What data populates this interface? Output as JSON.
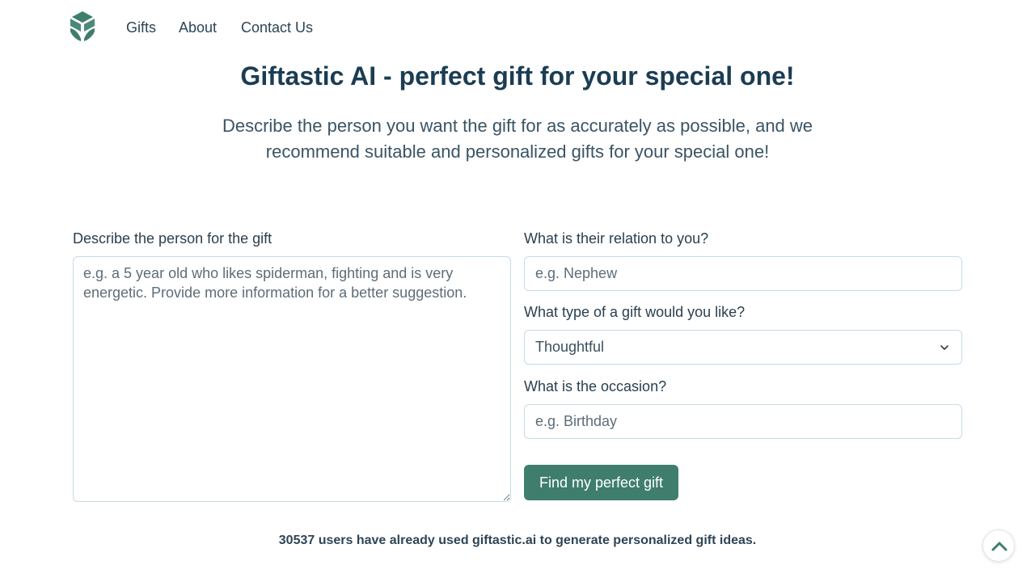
{
  "nav": {
    "logo_icon": "gift-box-logo-icon",
    "links": [
      "Gifts",
      "About",
      "Contact Us"
    ]
  },
  "hero": {
    "title": "Giftastic AI - perfect gift for your special one!",
    "subtitle": "Describe the person you want the gift for as accurately as possible, and we recommend suitable and personalized gifts for your special one!"
  },
  "form": {
    "description_label": "Describe the person for the gift",
    "description_placeholder": "e.g. a 5 year old who likes spiderman, fighting and is very energetic. Provide more information for a better suggestion.",
    "relation_label": "What is their relation to you?",
    "relation_placeholder": "e.g. Nephew",
    "type_label": "What type of a gift would you like?",
    "type_value": "Thoughtful",
    "occasion_label": "What is the occasion?",
    "occasion_placeholder": "e.g. Birthday",
    "submit_label": "Find my perfect gift"
  },
  "footer": {
    "users_text": "30537 users have already used giftastic.ai to generate personalized gift ideas."
  },
  "colors": {
    "brand_green": "#3f7d6d",
    "heading": "#1b3d54",
    "input_border": "#c7dbe6"
  },
  "icons": {
    "select_chevron": "chevron-down-icon",
    "scroll_top": "chevron-up-icon"
  }
}
